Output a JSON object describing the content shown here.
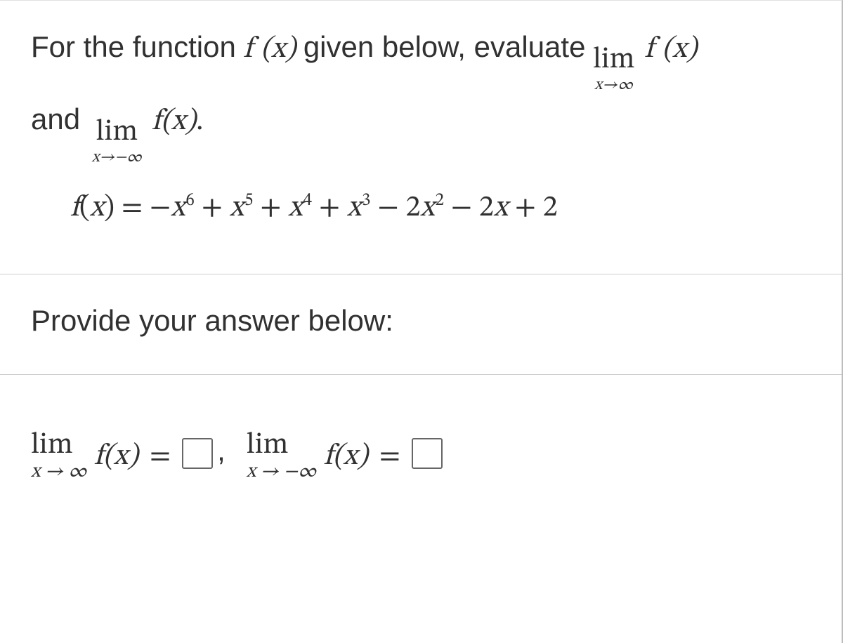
{
  "question": {
    "prefix_text": "For the function",
    "fn_name_inline": "f (x)",
    "middle_text": "given below, evaluate",
    "lim1_label": "lim",
    "lim1_sub": "x→∞",
    "lim1_expr": "f (x)",
    "and_text": "and",
    "lim2_label": "lim",
    "lim2_sub": "x→−∞",
    "lim2_expr": "f(x)",
    "period": "."
  },
  "function_def": {
    "lhs": "f(x) = ",
    "rhs_plain": "−x⁶ + x⁵ + x⁴ + x³ − 2x² − 2x + 2"
  },
  "answer_prompt": "Provide your answer below:",
  "answers": {
    "a1_lim": "lim",
    "a1_sub": "x → ∞",
    "a1_fx": "f(x)",
    "a1_eq": "=",
    "comma": ",",
    "a2_lim": "lim",
    "a2_sub": "x → −∞",
    "a2_fx": "f(x)",
    "a2_eq": "="
  }
}
